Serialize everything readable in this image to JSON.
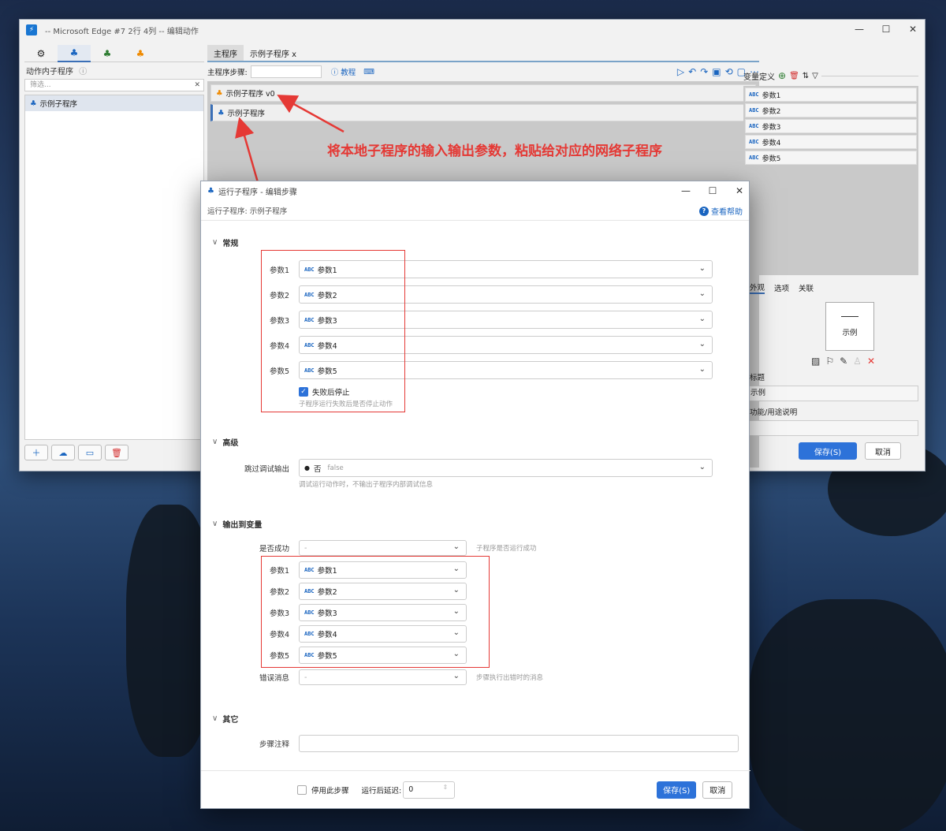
{
  "main_window": {
    "title": "-- Microsoft Edge #7 2行 4列 -- 编辑动作",
    "controls": {
      "minimize": "—",
      "maximize": "☐",
      "close": "✕"
    }
  },
  "left_panel": {
    "header": "动作内子程序",
    "filter_placeholder": "筛选...",
    "items": [
      "示例子程序"
    ]
  },
  "editor": {
    "tabs": [
      "主程序",
      "示例子程序 x"
    ],
    "step_label": "主程序步骤:",
    "tutorial": "教程",
    "steps": [
      "示例子程序 v0",
      "示例子程序"
    ]
  },
  "variables": {
    "header": "变量定义",
    "items": [
      "参数1",
      "参数2",
      "参数3",
      "参数4",
      "参数5"
    ],
    "abc_tag": "ABC"
  },
  "properties": {
    "tabs": [
      "外观",
      "选项",
      "关联"
    ],
    "preview_label": "示例",
    "title_label": "标题",
    "title_value": "示例",
    "desc_label": "功能/用途说明",
    "save": "保存(S)",
    "cancel": "取消"
  },
  "annotation": "将本地子程序的输入输出参数，粘贴给对应的网络子程序",
  "dialog": {
    "title": "运行子程序 - 编辑步骤",
    "subtitle": "运行子程序: 示例子程序",
    "help": "查看帮助",
    "sections": {
      "general": "常规",
      "advanced": "高级",
      "output": "输出到变量",
      "other": "其它"
    },
    "params": [
      {
        "label": "参数1",
        "value": "参数1"
      },
      {
        "label": "参数2",
        "value": "参数2"
      },
      {
        "label": "参数3",
        "value": "参数3"
      },
      {
        "label": "参数4",
        "value": "参数4"
      },
      {
        "label": "参数5",
        "value": "参数5"
      }
    ],
    "stop_on_fail": {
      "label": "失败后停止",
      "hint": "子程序运行失败后是否停止动作",
      "checked": true
    },
    "skip_debug": {
      "label": "跳过调试输出",
      "value": "否",
      "value2": "false",
      "hint": "调试运行动作时，不输出子程序内部调试信息"
    },
    "success": {
      "label": "是否成功",
      "value": "-",
      "hint": "子程序是否运行成功"
    },
    "outputs": [
      {
        "label": "参数1",
        "value": "参数1"
      },
      {
        "label": "参数2",
        "value": "参数2"
      },
      {
        "label": "参数3",
        "value": "参数3"
      },
      {
        "label": "参数4",
        "value": "参数4"
      },
      {
        "label": "参数5",
        "value": "参数5"
      }
    ],
    "error_msg": {
      "label": "错误消息",
      "value": "-",
      "hint": "步骤执行出错时的消息"
    },
    "comment_label": "步骤注释",
    "disable_label": "停用此步骤",
    "delay_label": "运行后延迟:",
    "delay_value": "0",
    "save": "保存(S)",
    "cancel": "取消"
  }
}
